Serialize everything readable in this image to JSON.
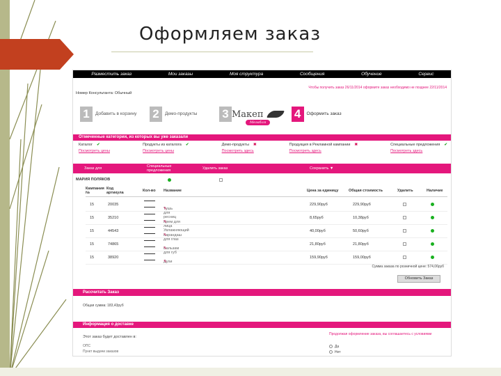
{
  "slide": {
    "title": "Оформляем заказ"
  },
  "topnav": [
    "Разместить заказ",
    "Мои заказы",
    "Моя структура",
    "Сообщения",
    "Обучение",
    "Сервис"
  ],
  "notice": "Чтобы получить заказ 26/11/2014 оформите заказ необходимо не позднее 22/11/2014",
  "user_line": "Номер Консультанта: Обычный",
  "steps": [
    {
      "num": "1",
      "label": "Добавить в корзину"
    },
    {
      "num": "2",
      "label": "Демо-продукты"
    },
    {
      "num": "3",
      "label": ""
    },
    {
      "num": "4",
      "label": "Оформить заказ"
    }
  ],
  "logo": {
    "name": "Макеп",
    "sub": "Мегабля"
  },
  "categories": {
    "header": "Отмеченные категории, из которых вы уже заказали",
    "items": [
      {
        "label": "Каталог",
        "link": "Посмотреть цены",
        "mark": "✔"
      },
      {
        "label": "Продукты из каталога",
        "link": "Посмотреть цены",
        "mark": "✔"
      },
      {
        "label": "Демо-продукты",
        "link": "Посмотреть здесь",
        "mark": "✖"
      },
      {
        "label": "Продукция в Рекламной кампании",
        "link": "Посмотреть здесь",
        "mark": "✖"
      },
      {
        "label": "Специальные предложения",
        "link": "Посмотреть здесь",
        "mark": "✔"
      }
    ]
  },
  "action_bar": {
    "add": "Заказ для",
    "special": "Специальные предложения",
    "delete": "Удалить заказ",
    "more": "Сохранить ▼"
  },
  "brand": "МАРИЯ ПОЛЯКОВ",
  "table": {
    "headers": [
      "Кампания №",
      "Код артикула",
      "Кол-во",
      "Название",
      "Цена за единицу",
      "Общая стоимость",
      "Удалить",
      "Наличие"
    ],
    "rows": [
      {
        "campaign": "15",
        "code": "20035",
        "name": "Тушь для ресниц",
        "price": "229,90руб",
        "total": "229,90руб"
      },
      {
        "campaign": "15",
        "code": "35210",
        "name": "Крем для лица Увлажняющий",
        "price": "8,65руб",
        "total": "10,38руб"
      },
      {
        "campaign": "15",
        "code": "44543",
        "name": "Карандаш для глаз",
        "price": "40,00руб",
        "total": "50,60руб"
      },
      {
        "campaign": "15",
        "code": "74865",
        "name": "Бальзам для губ",
        "price": "21,80руб",
        "total": "21,80руб"
      },
      {
        "campaign": "15",
        "code": "38920",
        "name": "Духи",
        "price": "159,90руб",
        "total": "159,00руб"
      }
    ]
  },
  "sum_line": "Сумма заказа по розничной цене: 574,06руб",
  "update_button": "Обновить Заказ",
  "calc_header": "Рассчитать Заказ",
  "calc_line": "Общая сумма: 183,43руб",
  "delivery": {
    "header": "Информация о доставке",
    "question": "Этот заказ будет доставлен в:",
    "options": [
      "ОПС",
      "Пункт выдачи заказов"
    ],
    "note": "Продолжая оформление заказа, вы соглашаетесь с условиями",
    "radio": [
      "Да",
      "Нет"
    ]
  },
  "colors": {
    "accent": "#e4177c",
    "nav": "#000000",
    "ok": "#2aa52a",
    "available": "#19b01f",
    "tab": "#c0392b"
  }
}
